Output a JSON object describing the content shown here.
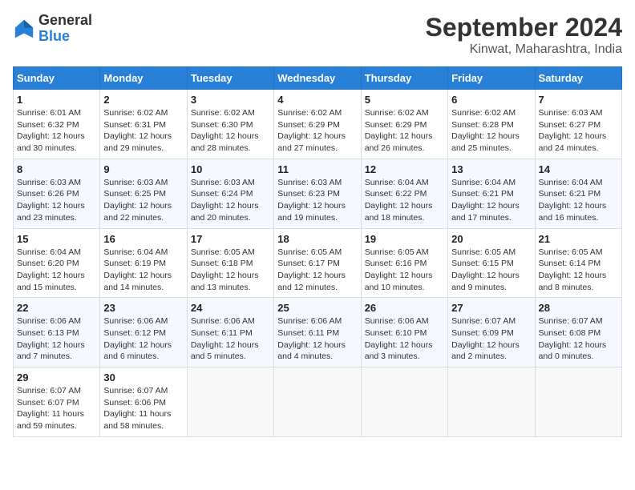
{
  "header": {
    "logo": {
      "general": "General",
      "blue": "Blue"
    },
    "title": "September 2024",
    "location": "Kinwat, Maharashtra, India"
  },
  "calendar": {
    "headers": [
      "Sunday",
      "Monday",
      "Tuesday",
      "Wednesday",
      "Thursday",
      "Friday",
      "Saturday"
    ],
    "weeks": [
      [
        {
          "day": "",
          "info": ""
        },
        {
          "day": "2",
          "info": "Sunrise: 6:02 AM\nSunset: 6:31 PM\nDaylight: 12 hours\nand 29 minutes."
        },
        {
          "day": "3",
          "info": "Sunrise: 6:02 AM\nSunset: 6:30 PM\nDaylight: 12 hours\nand 28 minutes."
        },
        {
          "day": "4",
          "info": "Sunrise: 6:02 AM\nSunset: 6:29 PM\nDaylight: 12 hours\nand 27 minutes."
        },
        {
          "day": "5",
          "info": "Sunrise: 6:02 AM\nSunset: 6:29 PM\nDaylight: 12 hours\nand 26 minutes."
        },
        {
          "day": "6",
          "info": "Sunrise: 6:02 AM\nSunset: 6:28 PM\nDaylight: 12 hours\nand 25 minutes."
        },
        {
          "day": "7",
          "info": "Sunrise: 6:03 AM\nSunset: 6:27 PM\nDaylight: 12 hours\nand 24 minutes."
        }
      ],
      [
        {
          "day": "1",
          "info": "Sunrise: 6:01 AM\nSunset: 6:32 PM\nDaylight: 12 hours\nand 30 minutes.",
          "first": true
        },
        {
          "day": "8",
          "info": "Sunrise: 6:03 AM\nSunset: 6:26 PM\nDaylight: 12 hours\nand 23 minutes."
        },
        {
          "day": "9",
          "info": "Sunrise: 6:03 AM\nSunset: 6:25 PM\nDaylight: 12 hours\nand 22 minutes."
        },
        {
          "day": "10",
          "info": "Sunrise: 6:03 AM\nSunset: 6:24 PM\nDaylight: 12 hours\nand 20 minutes."
        },
        {
          "day": "11",
          "info": "Sunrise: 6:03 AM\nSunset: 6:23 PM\nDaylight: 12 hours\nand 19 minutes."
        },
        {
          "day": "12",
          "info": "Sunrise: 6:04 AM\nSunset: 6:22 PM\nDaylight: 12 hours\nand 18 minutes."
        },
        {
          "day": "13",
          "info": "Sunrise: 6:04 AM\nSunset: 6:21 PM\nDaylight: 12 hours\nand 17 minutes."
        },
        {
          "day": "14",
          "info": "Sunrise: 6:04 AM\nSunset: 6:21 PM\nDaylight: 12 hours\nand 16 minutes."
        }
      ],
      [
        {
          "day": "15",
          "info": "Sunrise: 6:04 AM\nSunset: 6:20 PM\nDaylight: 12 hours\nand 15 minutes."
        },
        {
          "day": "16",
          "info": "Sunrise: 6:04 AM\nSunset: 6:19 PM\nDaylight: 12 hours\nand 14 minutes."
        },
        {
          "day": "17",
          "info": "Sunrise: 6:05 AM\nSunset: 6:18 PM\nDaylight: 12 hours\nand 13 minutes."
        },
        {
          "day": "18",
          "info": "Sunrise: 6:05 AM\nSunset: 6:17 PM\nDaylight: 12 hours\nand 12 minutes."
        },
        {
          "day": "19",
          "info": "Sunrise: 6:05 AM\nSunset: 6:16 PM\nDaylight: 12 hours\nand 10 minutes."
        },
        {
          "day": "20",
          "info": "Sunrise: 6:05 AM\nSunset: 6:15 PM\nDaylight: 12 hours\nand 9 minutes."
        },
        {
          "day": "21",
          "info": "Sunrise: 6:05 AM\nSunset: 6:14 PM\nDaylight: 12 hours\nand 8 minutes."
        }
      ],
      [
        {
          "day": "22",
          "info": "Sunrise: 6:06 AM\nSunset: 6:13 PM\nDaylight: 12 hours\nand 7 minutes."
        },
        {
          "day": "23",
          "info": "Sunrise: 6:06 AM\nSunset: 6:12 PM\nDaylight: 12 hours\nand 6 minutes."
        },
        {
          "day": "24",
          "info": "Sunrise: 6:06 AM\nSunset: 6:11 PM\nDaylight: 12 hours\nand 5 minutes."
        },
        {
          "day": "25",
          "info": "Sunrise: 6:06 AM\nSunset: 6:11 PM\nDaylight: 12 hours\nand 4 minutes."
        },
        {
          "day": "26",
          "info": "Sunrise: 6:06 AM\nSunset: 6:10 PM\nDaylight: 12 hours\nand 3 minutes."
        },
        {
          "day": "27",
          "info": "Sunrise: 6:07 AM\nSunset: 6:09 PM\nDaylight: 12 hours\nand 2 minutes."
        },
        {
          "day": "28",
          "info": "Sunrise: 6:07 AM\nSunset: 6:08 PM\nDaylight: 12 hours\nand 0 minutes."
        }
      ],
      [
        {
          "day": "29",
          "info": "Sunrise: 6:07 AM\nSunset: 6:07 PM\nDaylight: 11 hours\nand 59 minutes."
        },
        {
          "day": "30",
          "info": "Sunrise: 6:07 AM\nSunset: 6:06 PM\nDaylight: 11 hours\nand 58 minutes."
        },
        {
          "day": "",
          "info": ""
        },
        {
          "day": "",
          "info": ""
        },
        {
          "day": "",
          "info": ""
        },
        {
          "day": "",
          "info": ""
        },
        {
          "day": "",
          "info": ""
        }
      ]
    ]
  }
}
